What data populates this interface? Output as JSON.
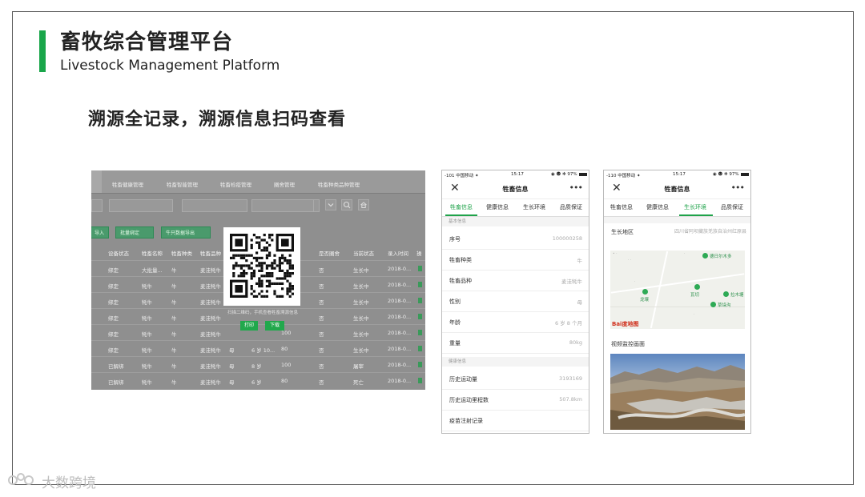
{
  "slide": {
    "title_cn": "畜牧综合管理平台",
    "title_en": "Livestock Management Platform",
    "subtitle": "溯源全记录，溯源信息扫码查看",
    "accent_color": "#19a64a"
  },
  "desktop": {
    "tabs": [
      "牲畜健康管理",
      "牲畜智能管理",
      "牲畜检疫管理",
      "圈舍管理",
      "牲畜种类品种管理"
    ],
    "buttons": [
      "导入",
      "批量绑定",
      "牛只数据导出"
    ],
    "columns": [
      "设备状态",
      "牲畜名称",
      "牲畜种类",
      "牲畜品种",
      "",
      "",
      "",
      "是否圈舍",
      "当前状态",
      "录入时间",
      "操"
    ],
    "rows": [
      [
        "绑定",
        "大批量...",
        "牛",
        "麦洼牦牛",
        "",
        "",
        "",
        "否",
        "生长中",
        "2018-0..."
      ],
      [
        "绑定",
        "牦牛",
        "牛",
        "麦洼牦牛",
        "",
        "",
        "",
        "否",
        "生长中",
        "2018-0..."
      ],
      [
        "绑定",
        "牦牛",
        "牛",
        "麦洼牦牛",
        "",
        "",
        "",
        "否",
        "生长中",
        "2018-0..."
      ],
      [
        "绑定",
        "牦牛",
        "牛",
        "麦洼牦牛",
        "",
        "",
        "",
        "否",
        "生长中",
        "2018-0..."
      ],
      [
        "绑定",
        "牦牛",
        "牛",
        "麦洼牦牛",
        "",
        "",
        "100",
        "否",
        "生长中",
        "2018-0..."
      ],
      [
        "绑定",
        "牦牛",
        "牛",
        "麦洼牦牛",
        "母",
        "6 岁 10...",
        "80",
        "否",
        "生长中",
        "2018-0..."
      ],
      [
        "已解绑",
        "牦牛",
        "牛",
        "麦洼牦牛",
        "母",
        "8 岁",
        "100",
        "否",
        "屠宰",
        "2018-0..."
      ],
      [
        "已解绑",
        "牦牛",
        "牛",
        "麦洼牦牛",
        "母",
        "6 岁",
        "80",
        "否",
        "死亡",
        "2018-0..."
      ]
    ],
    "qr": {
      "caption": "扫描二维码，手机查看牲畜溯源信息",
      "print_label": "打印",
      "download_label": "下载"
    }
  },
  "phone1": {
    "status": {
      "carrier": "-101 中国移动 ✦",
      "time": "15:17",
      "battery": "◉ ☻ ✻ 97%"
    },
    "nav_title": "牲畜信息",
    "tabs": [
      "牲畜信息",
      "健康信息",
      "生长环境",
      "品质保证"
    ],
    "active_tab": 0,
    "section_basic": "基本信息",
    "section_health": "健康信息",
    "rows_basic": [
      {
        "label": "序号",
        "value": "100000258"
      },
      {
        "label": "牲畜种类",
        "value": "牛"
      },
      {
        "label": "牲畜品种",
        "value": "麦洼牦牛"
      },
      {
        "label": "性别",
        "value": "母"
      },
      {
        "label": "年龄",
        "value": "6 岁 8 个月"
      },
      {
        "label": "重量",
        "value": "80kg"
      }
    ],
    "rows_health": [
      {
        "label": "历史运动量",
        "value": "3193169"
      },
      {
        "label": "历史运动里程数",
        "value": "507.8km"
      },
      {
        "label": "疫苗注射记录",
        "value": ""
      }
    ]
  },
  "phone2": {
    "status": {
      "carrier": "-110 中国移动 ✦",
      "time": "15:17",
      "battery": "◉ ☻ ✻ 97%"
    },
    "nav_title": "牲畜信息",
    "tabs": [
      "牲畜信息",
      "健康信息",
      "生长环境",
      "品质保证"
    ],
    "active_tab": 2,
    "region_label": "生长地区",
    "region_value": "四川省阿坝藏族羌族自治州红原县",
    "map_places": [
      "德日尔木多",
      "龙壤",
      "瓦切",
      "拉木塘",
      "草垛沟"
    ],
    "map_logo": "Bai度地图",
    "video_label": "视频监控画面"
  },
  "watermark": "大数跨境"
}
